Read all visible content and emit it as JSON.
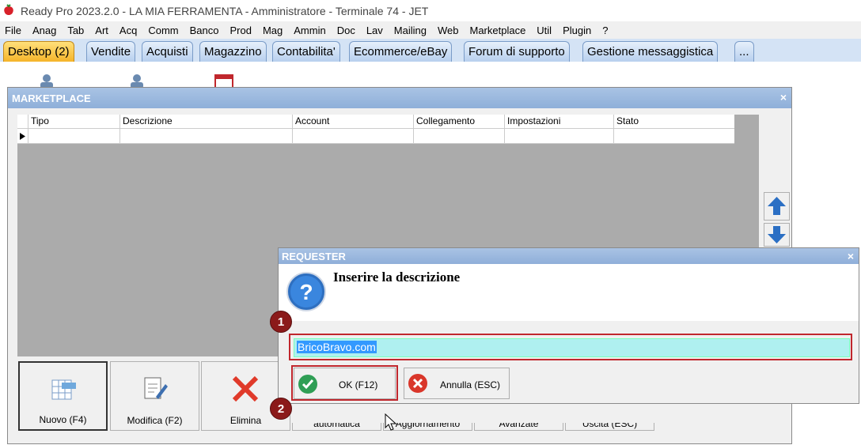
{
  "app": {
    "title": "Ready Pro 2023.2.0 - LA MIA FERRAMENTA - Amministratore - Terminale 74 - JET"
  },
  "menu": [
    "File",
    "Anag",
    "Tab",
    "Art",
    "Acq",
    "Comm",
    "Banco",
    "Prod",
    "Mag",
    "Ammin",
    "Doc",
    "Lav",
    "Mailing",
    "Web",
    "Marketplace",
    "Util",
    "Plugin",
    "?"
  ],
  "tabs": [
    "Desktop (2)",
    "Vendite",
    "Acquisti",
    "Magazzino",
    "Contabilita'",
    "Ecommerce/eBay",
    "Forum di supporto",
    "Gestione messaggistica",
    "..."
  ],
  "marketplace": {
    "title": "MARKETPLACE",
    "close": "×",
    "columns": [
      "Tipo",
      "Descrizione",
      "Account",
      "Collegamento",
      "Impostazioni",
      "Stato"
    ],
    "buttons": {
      "nuovo": "Nuovo (F4)",
      "modifica": "Modifica (F2)",
      "elimina": "Elimina",
      "automatica": "automatica",
      "aggiornamento": "Aggiornamento",
      "avanzate": "Avanzate",
      "uscita": "Uscita (ESC)"
    }
  },
  "requester": {
    "title": "REQUESTER",
    "close": "×",
    "prompt": "Inserire la descrizione",
    "value": "BricoBravo.com",
    "ok": "OK (F12)",
    "cancel": "Annulla (ESC)"
  },
  "badges": [
    "1",
    "2"
  ],
  "colors": {
    "accent": "#8fafd9",
    "highlight": "#c0272d",
    "input_bg": "#aff0f0",
    "active_tab": "#f5b42a"
  }
}
